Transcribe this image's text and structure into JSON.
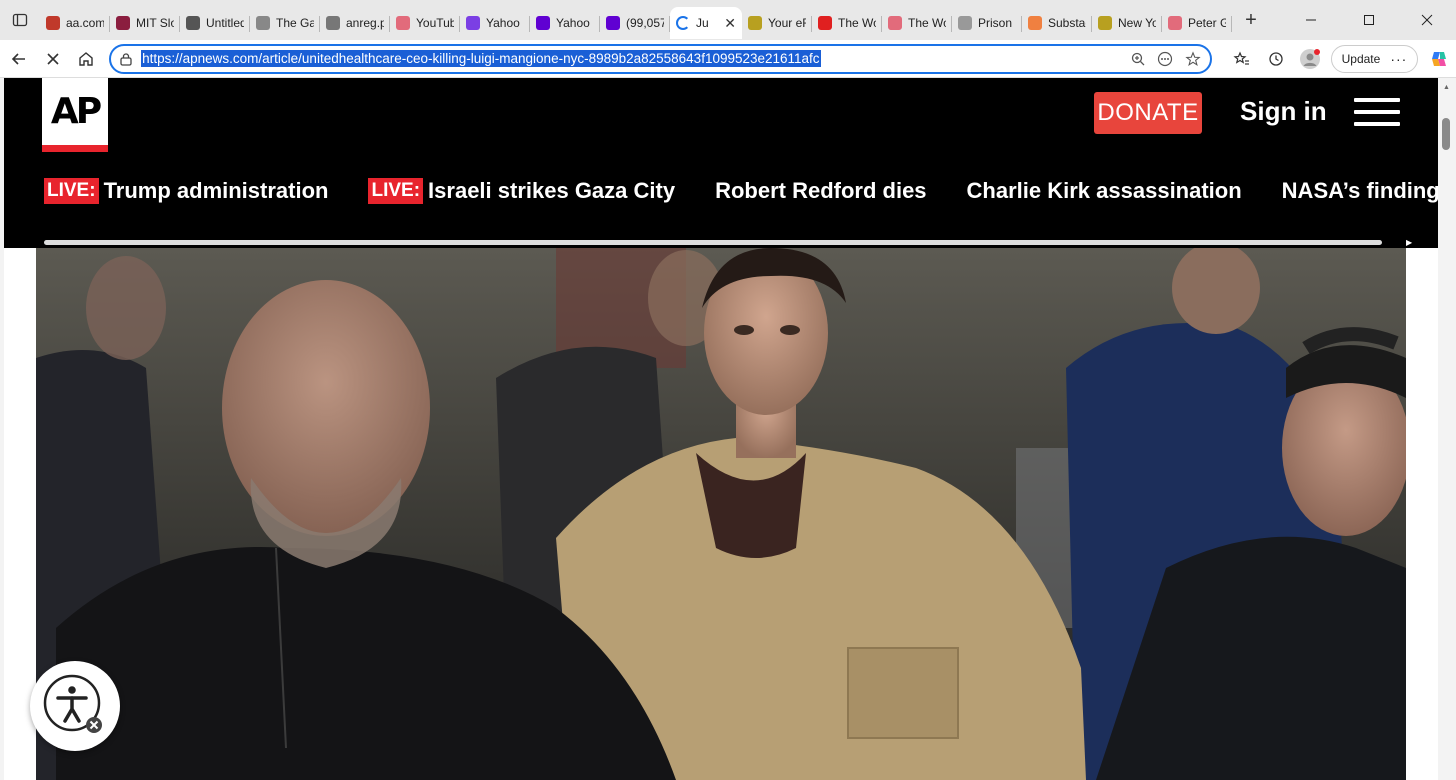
{
  "browser": {
    "tabs": [
      {
        "title": "aa.com",
        "fav_color": "#c0392b",
        "icon": "aa-favicon"
      },
      {
        "title": "MIT Slo",
        "fav_color": "#8b1e3f",
        "icon": "mit-sloan-favicon"
      },
      {
        "title": "Untitled",
        "fav_color": "#555555",
        "icon": "globe-icon"
      },
      {
        "title": "The Ga",
        "fav_color": "#888888",
        "icon": "gp-favicon"
      },
      {
        "title": "anreg.p",
        "fav_color": "#777777",
        "icon": "m-favicon"
      },
      {
        "title": "YouTub",
        "fav_color": "#e26b7b",
        "icon": "youtube-favicon"
      },
      {
        "title": "Yahoo",
        "fav_color": "#7b3fe4",
        "icon": "yahoo-favicon"
      },
      {
        "title": "Yahoo",
        "fav_color": "#6001d2",
        "icon": "yahoo-favicon"
      },
      {
        "title": "(99,057",
        "fav_color": "#6001d2",
        "icon": "yahoo-mail-favicon"
      },
      {
        "title": "Ju",
        "fav_color": "#1a73e8",
        "icon": "loading-spinner-icon",
        "active": true
      },
      {
        "title": "Your eF",
        "fav_color": "#b8a020",
        "icon": "e-favicon"
      },
      {
        "title": "The Wo",
        "fav_color": "#e02020",
        "icon": "youtube-favicon"
      },
      {
        "title": "The Wo",
        "fav_color": "#e26b7b",
        "icon": "youtube-favicon"
      },
      {
        "title": "Prison",
        "fav_color": "#999999",
        "icon": "bird-favicon"
      },
      {
        "title": "Substac",
        "fav_color": "#f08040",
        "icon": "substack-favicon"
      },
      {
        "title": "New Yo",
        "fav_color": "#b8a020",
        "icon": "e-favicon"
      },
      {
        "title": "Peter G",
        "fav_color": "#e26b7b",
        "icon": "youtube-favicon"
      }
    ],
    "url": "https://apnews.com/article/unitedhealthcare-ceo-killing-luigi-mangione-nyc-8989b2a82558643f1099523e21611afc",
    "update_label": "Update"
  },
  "page": {
    "logo_text": "AP",
    "donate_label": "DONATE",
    "signin_label": "Sign in",
    "live_label": "LIVE:",
    "trending": [
      {
        "label": "Trump administration",
        "live": true
      },
      {
        "label": "Israeli strikes Gaza City",
        "live": true
      },
      {
        "label": "Robert Redford dies",
        "live": false
      },
      {
        "label": "Charlie Kirk assassination",
        "live": false
      },
      {
        "label": "NASA’s findings on Ma",
        "live": false
      }
    ]
  }
}
